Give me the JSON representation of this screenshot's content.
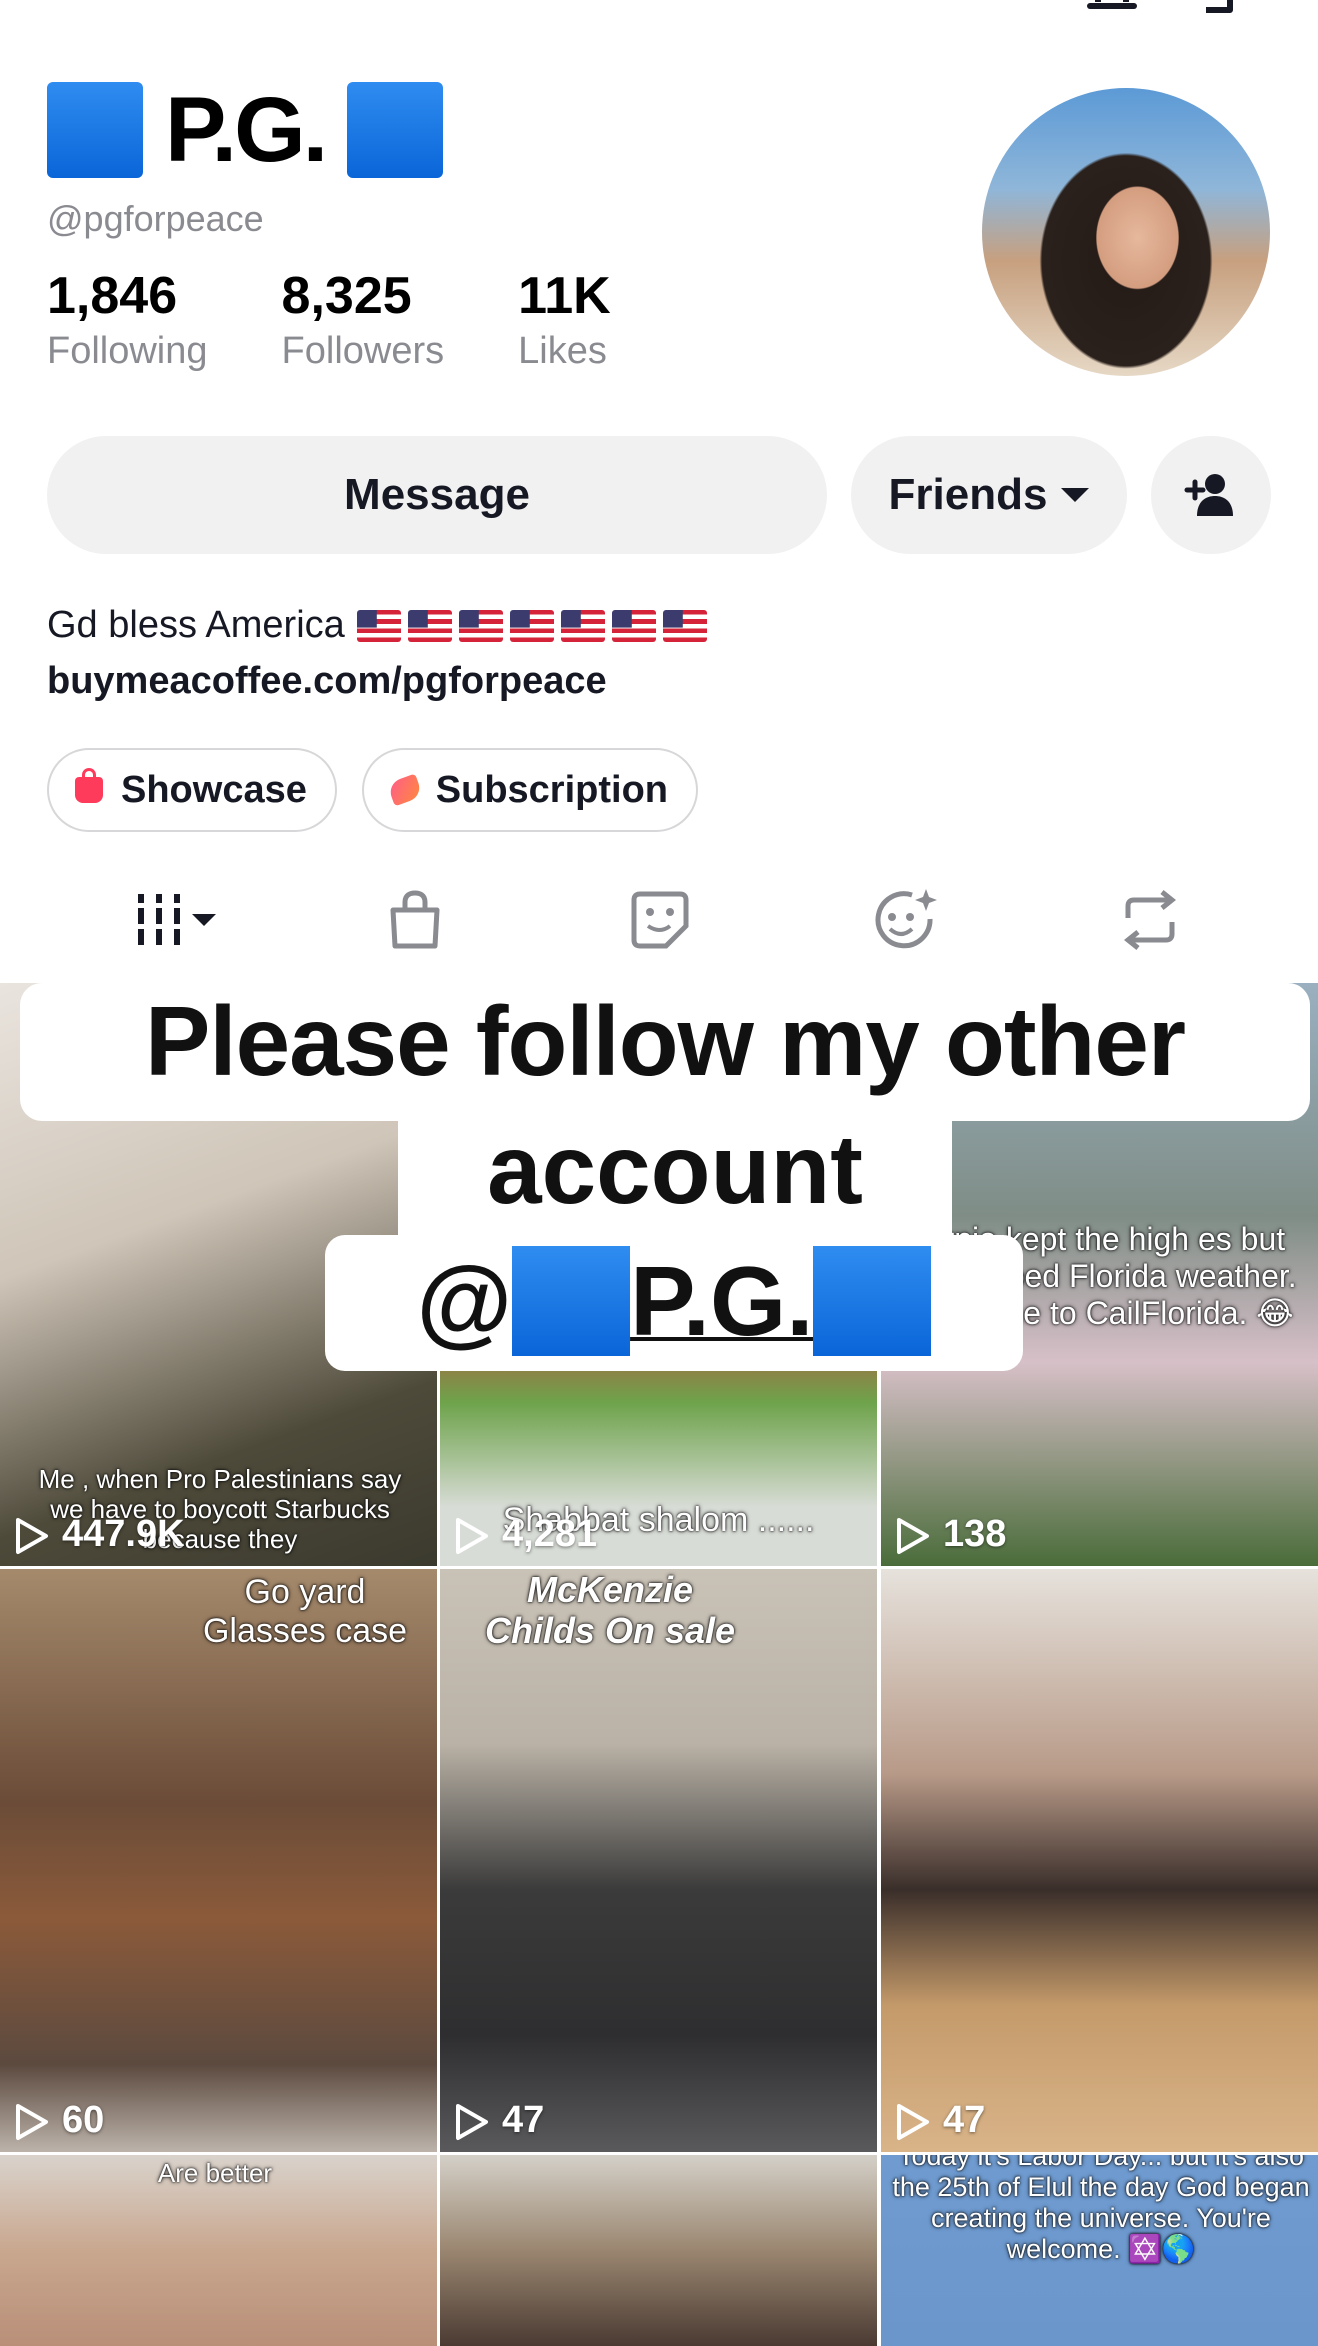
{
  "profile": {
    "display_name": "P.G.",
    "handle": "@pgforpeace",
    "stats": [
      {
        "value": "1,846",
        "label": "Following"
      },
      {
        "value": "8,325",
        "label": "Followers"
      },
      {
        "value": "11K",
        "label": "Likes"
      }
    ],
    "bio": "Gd bless America",
    "flag_count": 7,
    "link": "buymeacoffee.com/pgforpeace"
  },
  "actions": {
    "message": "Message",
    "friends": "Friends"
  },
  "pills": {
    "showcase": "Showcase",
    "subscription": "Subscription"
  },
  "overlay": {
    "line1": "Please follow my other",
    "line2": "account",
    "line3_prefix": "@",
    "line3_name": "P.G."
  },
  "videos": [
    {
      "views": "447.9K",
      "caption": "Me , when Pro Palestinians say we have to boycott Starbucks because they"
    },
    {
      "views": "4,281",
      "caption": "Shabbat shalom ......"
    },
    {
      "views": "138",
      "caption": "fornia kept the high es but subscribed Florida weather.\nWelcome to CailFlorida. 😂"
    },
    {
      "views": "60",
      "caption": "Go yard Glasses case"
    },
    {
      "views": "47",
      "caption": "McKenzie Childs On sale"
    },
    {
      "views": "47",
      "caption": ""
    },
    {
      "views": "",
      "caption": "Are better"
    },
    {
      "views": "",
      "caption": ""
    },
    {
      "views": "",
      "caption": "Today it's Labor Day... but it's also the 25th of Elul the day God began creating the universe. You're welcome. ✡️🌎"
    }
  ]
}
